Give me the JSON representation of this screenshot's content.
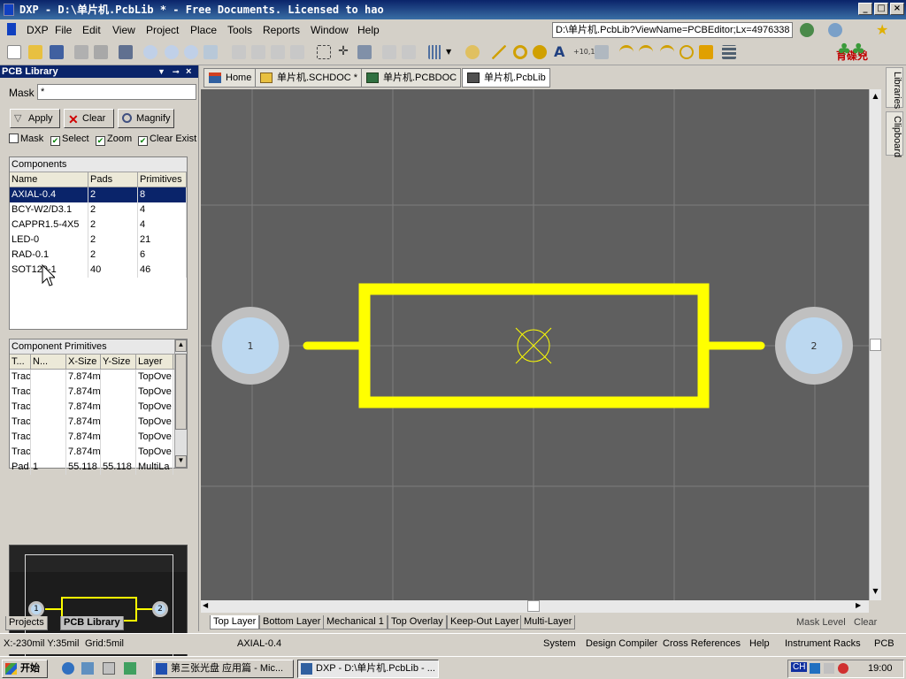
{
  "window": {
    "title": "DXP - D:\\单片机.PcbLib * - Free Documents. Licensed to hao"
  },
  "menu": [
    "DXP",
    "File",
    "Edit",
    "View",
    "Project",
    "Place",
    "Tools",
    "Reports",
    "Window",
    "Help"
  ],
  "address": "D:\\单片机.PcbLib?ViewName=PCBEditor;Lx=4976338",
  "logo_text": "育碟兇",
  "panel": {
    "title": "PCB Library",
    "mask_label": "Mask",
    "mask_value": "*",
    "apply": "Apply",
    "clear": "Clear",
    "magnify": "Magnify",
    "checks": {
      "mask": "Mask",
      "select": "Select",
      "zoom": "Zoom",
      "clear_exist": "Clear Exist"
    },
    "components_title": "Components",
    "components_headers": [
      "Name",
      "Pads",
      "Primitives"
    ],
    "components": [
      {
        "name": "AXIAL-0.4",
        "pads": "2",
        "prims": "8"
      },
      {
        "name": "BCY-W2/D3.1",
        "pads": "2",
        "prims": "4"
      },
      {
        "name": "CAPPR1.5-4X5",
        "pads": "2",
        "prims": "4"
      },
      {
        "name": "LED-0",
        "pads": "2",
        "prims": "21"
      },
      {
        "name": "RAD-0.1",
        "pads": "2",
        "prims": "6"
      },
      {
        "name": "SOT129-1",
        "pads": "40",
        "prims": "46"
      }
    ],
    "primitives_title": "Component Primitives",
    "primitives_headers": [
      "T...",
      "N...",
      "X-Size",
      "Y-Size",
      "Layer"
    ],
    "primitives": [
      {
        "t": "Trac",
        "n": "",
        "x": "7.874m",
        "y": "",
        "layer": "TopOve"
      },
      {
        "t": "Trac",
        "n": "",
        "x": "7.874m",
        "y": "",
        "layer": "TopOve"
      },
      {
        "t": "Trac",
        "n": "",
        "x": "7.874m",
        "y": "",
        "layer": "TopOve"
      },
      {
        "t": "Trac",
        "n": "",
        "x": "7.874m",
        "y": "",
        "layer": "TopOve"
      },
      {
        "t": "Trac",
        "n": "",
        "x": "7.874m",
        "y": "",
        "layer": "TopOve"
      },
      {
        "t": "Trac",
        "n": "",
        "x": "7.874m",
        "y": "",
        "layer": "TopOve"
      },
      {
        "t": "Pad",
        "n": "1",
        "x": "55.118",
        "y": "55.118",
        "layer": "MultiLa"
      }
    ],
    "tabs": [
      "Projects",
      "PCB Library"
    ]
  },
  "doc_tabs": [
    "Home",
    "单片机.SCHDOC *",
    "单片机.PCBDOC",
    "单片机.PcbLib"
  ],
  "pads": [
    "1",
    "2"
  ],
  "layer_tabs": [
    "Top Layer",
    "Bottom Layer",
    "Mechanical 1",
    "Top Overlay",
    "Keep-Out Layer",
    "Multi-Layer"
  ],
  "mask_level": "Mask Level",
  "clear_btn": "Clear",
  "right_tabs": [
    "Libraries",
    "Clipboard"
  ],
  "status": {
    "coords": "X:-230mil Y:35mil",
    "grid": "Grid:5mil",
    "component": "AXIAL-0.4",
    "buttons": [
      "System",
      "Design Compiler",
      "Cross References",
      "Help",
      "Instrument Racks",
      "PCB"
    ]
  },
  "taskbar": {
    "start": "开始",
    "tasks": [
      "第三张光盘 应用篇 - Mic...",
      "DXP - D:\\单片机.PcbLib - ..."
    ],
    "tray_ch": "CH",
    "time": "19:00"
  },
  "colors": {
    "silk": "#ffff00",
    "pad_ring": "#c0c0c0",
    "pad_hole": "#bcd8f0",
    "canvas": "#5f5f5f",
    "title": "#0a246a"
  }
}
